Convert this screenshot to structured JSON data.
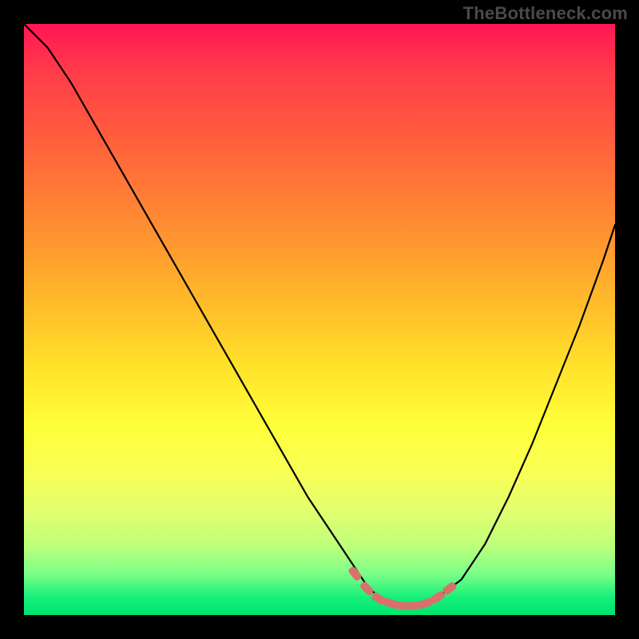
{
  "watermark": "TheBottleneck.com",
  "colors": {
    "background": "#000000",
    "curve": "#000000",
    "marker": "#d9706b"
  },
  "chart_data": {
    "type": "line",
    "title": "",
    "xlabel": "",
    "ylabel": "",
    "xlim": [
      0,
      100
    ],
    "ylim": [
      0,
      100
    ],
    "series": [
      {
        "name": "bottleneck-curve",
        "x": [
          0,
          4,
          8,
          12,
          16,
          20,
          24,
          28,
          32,
          36,
          40,
          44,
          48,
          52,
          56,
          58,
          60,
          62,
          64,
          66,
          68,
          70,
          74,
          78,
          82,
          86,
          90,
          94,
          98,
          100
        ],
        "y": [
          100,
          96,
          90,
          83,
          76,
          69,
          62,
          55,
          48,
          41,
          34,
          27,
          20,
          14,
          8,
          5,
          3,
          2,
          1.5,
          1.5,
          2,
          3,
          6,
          12,
          20,
          29,
          39,
          49,
          60,
          66
        ]
      }
    ],
    "markers": {
      "name": "optimal-range",
      "x": [
        56,
        58,
        60,
        62,
        64,
        66,
        68,
        70,
        72
      ],
      "y": [
        7,
        4.5,
        2.8,
        2.0,
        1.6,
        1.6,
        2.0,
        3.0,
        4.5
      ]
    }
  }
}
